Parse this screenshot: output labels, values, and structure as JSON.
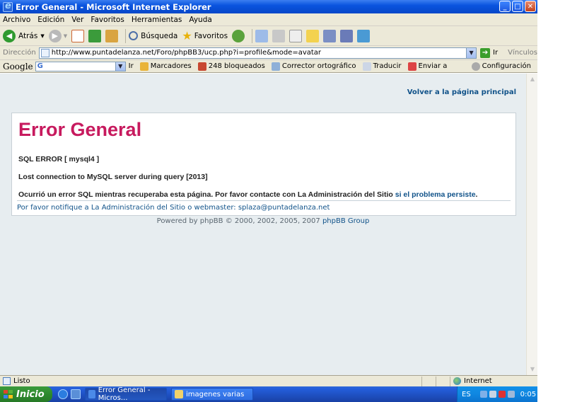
{
  "window": {
    "title": "Error General - Microsoft Internet Explorer",
    "buttons": {
      "minimize": "_",
      "maximize": "□",
      "close": "✕"
    }
  },
  "menu": [
    "Archivo",
    "Edición",
    "Ver",
    "Favoritos",
    "Herramientas",
    "Ayuda"
  ],
  "toolbar": {
    "back_label": "Atrás",
    "search_label": "Búsqueda",
    "favorites_label": "Favoritos"
  },
  "address": {
    "label": "Dirección",
    "url": "http://www.puntadelanza.net/Foro/phpBB3/ucp.php?i=profile&mode=avatar",
    "go_label": "Ir",
    "links_label": "Vínculos"
  },
  "googlebar": {
    "logo": "Google",
    "go_label": "Ir",
    "bookmarks": "Marcadores",
    "blocked": "248 bloqueados",
    "spellcheck": "Corrector ortográfico",
    "translate": "Traducir",
    "send": "Enviar a",
    "settings": "Configuración"
  },
  "page": {
    "back_link": "Volver a la página principal",
    "error_title": "Error General",
    "sql_error": "SQL ERROR [ mysql4 ]",
    "lost_connection": "Lost connection to MySQL server during query [2013]",
    "message_lead": "Ocurrió un error SQL mientras recuperaba esta página. Por favor contacte con La Administración del Sitio",
    "message_link": "si el problema persiste",
    "notify": "Por favor notifique a La Administración del Sitio o webmaster: splaza@puntadelanza.net",
    "powered_text": "Powered by phpBB © 2000, 2002, 2005, 2007",
    "powered_link": "phpBB Group"
  },
  "status": {
    "text": "Listo",
    "zone": "Internet"
  },
  "taskbar": {
    "start": "Inicio",
    "tasks": [
      "Error General - Micros...",
      "imagenes varias"
    ],
    "lang": "ES",
    "clock": "0:05"
  }
}
